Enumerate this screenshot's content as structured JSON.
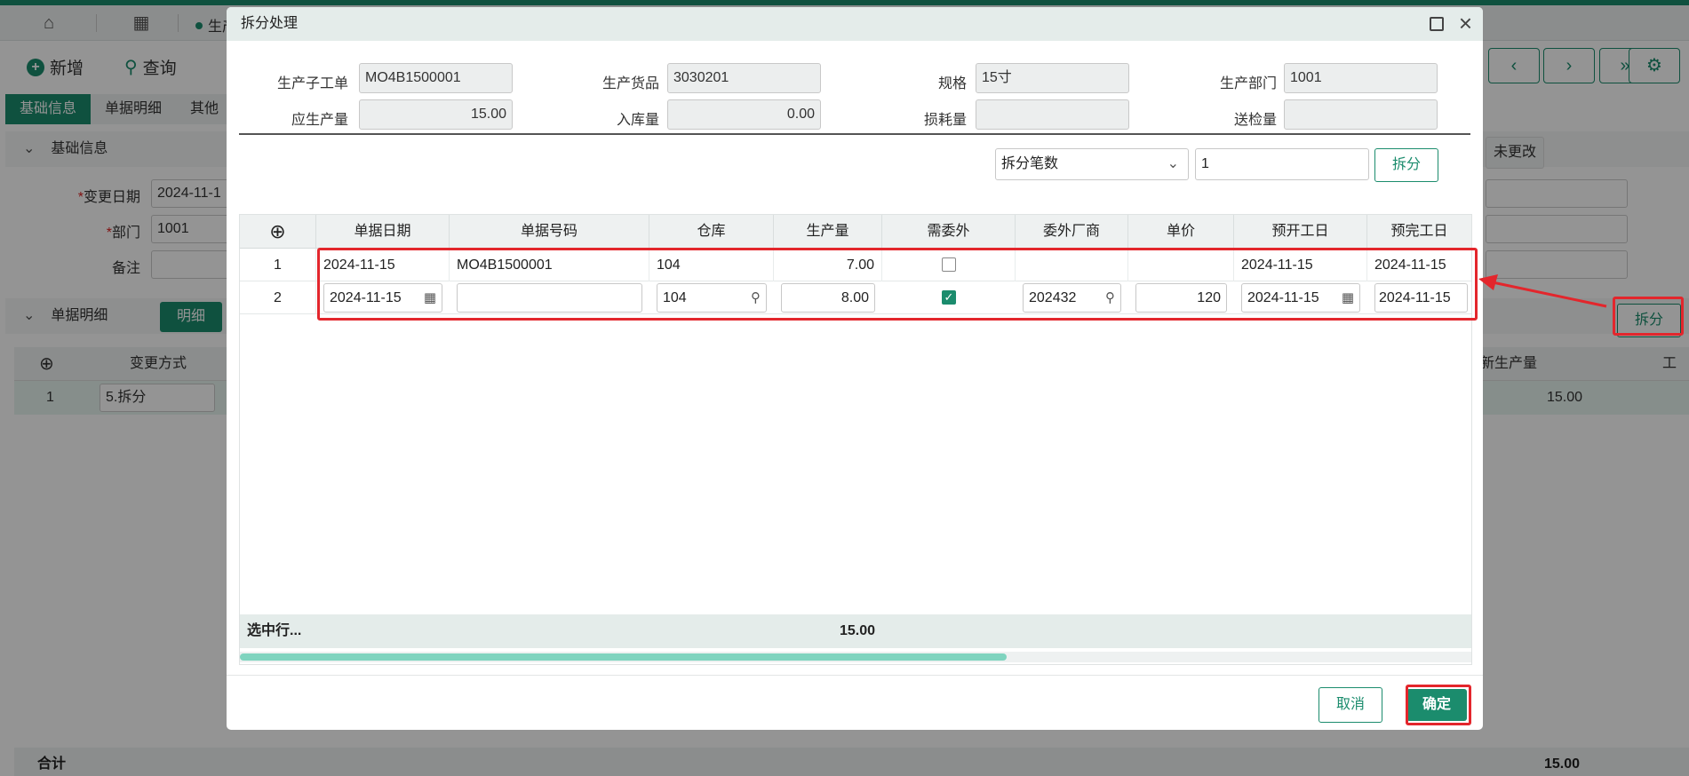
{
  "background": {
    "tab_doc": "生产",
    "toolbar": {
      "new": "新增",
      "query": "查询"
    },
    "sections": [
      "基础信息",
      "单据明细",
      "其他"
    ],
    "basic_info": {
      "title": "基础信息",
      "change_date_label": "变更日期",
      "change_date_value": "2024-11-1",
      "dept_label": "部门",
      "dept_value": "1001",
      "remark_label": "备注",
      "not_changed": "未更改"
    },
    "detail": {
      "title": "单据明细",
      "detail_btn": "明细",
      "split_btn": "拆分",
      "col_change_mode": "变更方式",
      "col_new_qty": "新生产量",
      "col_work": "工时",
      "row_no": "1",
      "row_mode": "5.拆分",
      "row_new_qty": "15.00",
      "total_label": "合计",
      "total_value": "15.00"
    }
  },
  "dialog": {
    "title": "拆分处理",
    "fields": {
      "sub_order_label": "生产子工单",
      "sub_order_value": "MO4B1500001",
      "product_label": "生产货品",
      "product_value": "3030201",
      "spec_label": "规格",
      "spec_value": "15寸",
      "dept_label": "生产部门",
      "dept_value": "1001",
      "plan_qty_label": "应生产量",
      "plan_qty_value": "15.00",
      "in_qty_label": "入库量",
      "in_qty_value": "0.00",
      "loss_label": "损耗量",
      "loss_value": "",
      "inspect_label": "送检量",
      "inspect_value": ""
    },
    "split": {
      "mode": "拆分笔数",
      "count": "1",
      "button": "拆分"
    },
    "grid": {
      "columns": [
        "单据日期",
        "单据号码",
        "仓库",
        "生产量",
        "需委外",
        "委外厂商",
        "单价",
        "预开工日",
        "预完工日"
      ],
      "rows": [
        {
          "no": "1",
          "date": "2024-11-15",
          "doc_no": "MO4B1500001",
          "warehouse": "104",
          "qty": "7.00",
          "outsource": false,
          "vendor": "",
          "price": "",
          "start": "2024-11-15",
          "end": "2024-11-15"
        },
        {
          "no": "2",
          "date": "2024-11-15",
          "doc_no": "",
          "warehouse": "104",
          "qty": "8.00",
          "outsource": true,
          "vendor": "202432",
          "price": "120",
          "start": "2024-11-15",
          "end": "2024-11-15"
        }
      ],
      "footer_label": "选中行...",
      "footer_qty": "15.00"
    },
    "cancel": "取消",
    "confirm": "确定"
  },
  "colors": {
    "accent": "#1b8c6d",
    "highlight": "#e3262c"
  }
}
